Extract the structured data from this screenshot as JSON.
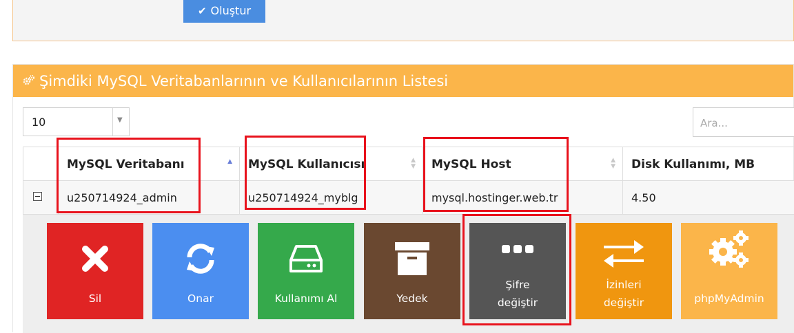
{
  "top": {
    "create_label": "Oluştur"
  },
  "panel": {
    "title": "Şimdiki MySQL Veritabanlarının ve Kullanıcılarının Listesi"
  },
  "controls": {
    "page_size": "10",
    "search_placeholder": "Ara..."
  },
  "table": {
    "headers": [
      "MySQL Veritabanı",
      "MySQL Kullanıcısı",
      "MySQL Host",
      "Disk Kullanımı, MB"
    ],
    "row": [
      "u250714924_admin",
      "u250714924_myblg",
      "mysql.hostinger.web.tr",
      "4.50"
    ]
  },
  "actions": [
    {
      "label": "Sil",
      "color": "#e02424",
      "icon": "close-icon"
    },
    {
      "label": "Onar",
      "color": "#4b8ef0",
      "icon": "refresh-icon"
    },
    {
      "label": "Kullanımı Al",
      "color": "#35a94b",
      "icon": "hard-drive-icon"
    },
    {
      "label": "Yedek",
      "color": "#6a4830",
      "icon": "archive-icon"
    },
    {
      "label_line1": "Şifre",
      "label_line2": "değiştir",
      "color": "#555555",
      "icon": "ellipsis-icon"
    },
    {
      "label_line1": "İzinleri",
      "label_line2": "değiştir",
      "color": "#f0960f",
      "icon": "exchange-icon"
    },
    {
      "label": "phpMyAdmin",
      "color": "#fbb54a",
      "icon": "gears-icon"
    }
  ],
  "colors": {
    "header_orange": "#fbb54a",
    "highlight_red": "#e8121c",
    "button_blue": "#4a8de0"
  }
}
